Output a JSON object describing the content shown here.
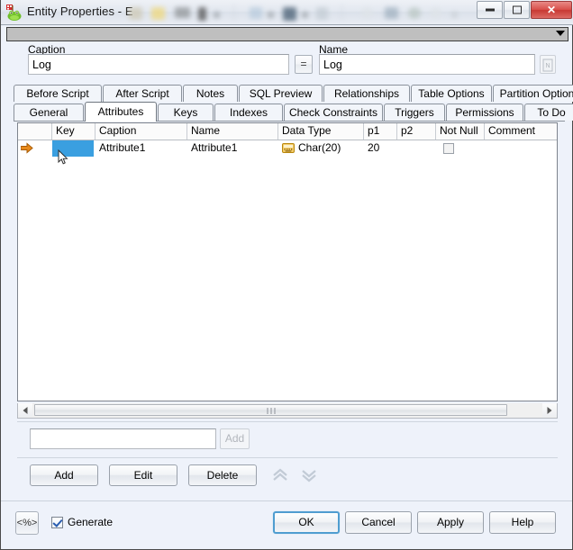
{
  "window": {
    "title": "Entity Properties - E",
    "app_icon": "frog-icon",
    "controls": {
      "minimize": "minimize-icon",
      "maximize": "maximize-icon",
      "close": "close-icon"
    }
  },
  "toolstrip": {
    "dropdown": "chevron-down-icon"
  },
  "fields": {
    "caption": {
      "label": "Caption",
      "label_accel": "i",
      "value": "Log"
    },
    "equals_button": "=",
    "name": {
      "label": "Name",
      "label_accel": "N",
      "value": "Log"
    },
    "naming_button": "naming-standards-icon"
  },
  "tabs": {
    "row1": [
      {
        "label": "Before Script",
        "selected": false
      },
      {
        "label": "After Script",
        "selected": false
      },
      {
        "label": "Notes",
        "selected": false
      },
      {
        "label": "SQL Preview",
        "selected": false
      },
      {
        "label": "Relationships",
        "selected": false
      },
      {
        "label": "Table Options",
        "selected": false
      },
      {
        "label": "Partition Options",
        "selected": false
      }
    ],
    "row2": [
      {
        "label": "General",
        "selected": false
      },
      {
        "label": "Attributes",
        "selected": true
      },
      {
        "label": "Keys",
        "selected": false
      },
      {
        "label": "Indexes",
        "selected": false
      },
      {
        "label": "Check Constraints",
        "selected": false
      },
      {
        "label": "Triggers",
        "selected": false
      },
      {
        "label": "Permissions",
        "selected": false
      },
      {
        "label": "To Do",
        "selected": false
      }
    ]
  },
  "grid": {
    "columns": [
      "Key",
      "Caption",
      "Name",
      "Data Type",
      "p1",
      "p2",
      "Not Null",
      "Comment"
    ],
    "rows": [
      {
        "marker": "current-row-arrow",
        "key": "",
        "key_selected": true,
        "caption": "Attribute1",
        "name": "Attribute1",
        "data_type": "Char(20)",
        "data_type_icon": "datatype-icon",
        "p1": "20",
        "p2": "",
        "not_null": false,
        "comment": ""
      }
    ]
  },
  "scrollbar": {
    "left_arrow": "triangle-left-icon",
    "right_arrow": "triangle-right-icon",
    "grip": "scroll-grip-icon"
  },
  "quick_add": {
    "input_value": "",
    "input_placeholder": "",
    "button_label": "Add",
    "button_disabled": true
  },
  "actions": {
    "add": "Add",
    "edit": "Edit",
    "delete": "Delete",
    "move_up": "chevrons-up-icon",
    "move_down": "chevrons-down-icon"
  },
  "footer": {
    "macro_button": "<%>",
    "generate": {
      "label": "Generate",
      "checked": true
    },
    "ok": "OK",
    "cancel": "Cancel",
    "apply": "Apply",
    "help": "Help"
  },
  "colors": {
    "selection_blue": "#3a9fe0",
    "row_marker_orange": "#e07818",
    "default_button_border": "#4f9dd0",
    "close_button_red": "#c73833",
    "window_background": "#eef2fa"
  }
}
